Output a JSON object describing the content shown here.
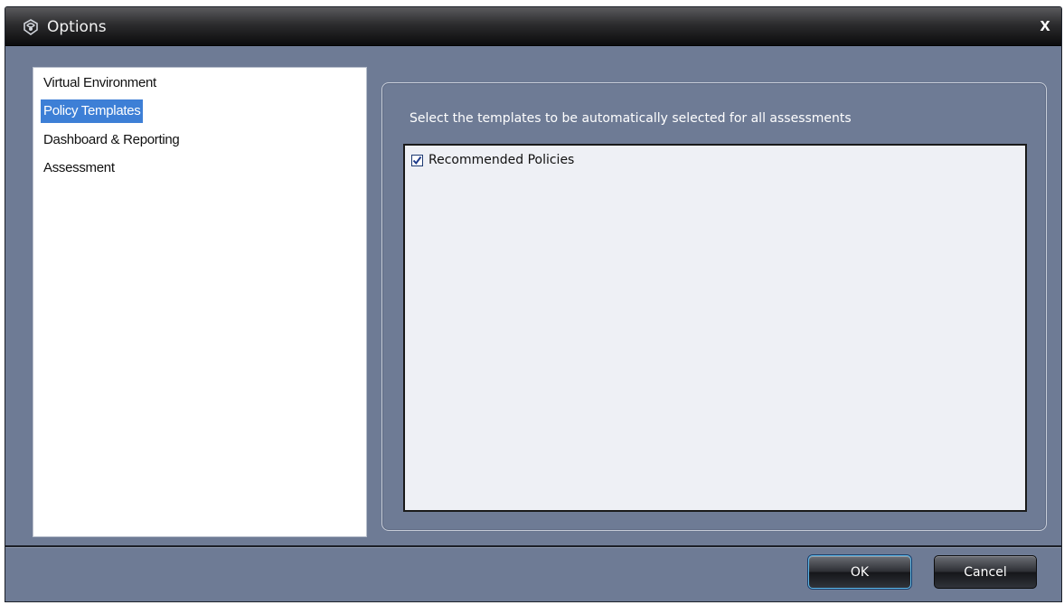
{
  "window": {
    "title": "Options",
    "icon": "app-logo-icon",
    "close_glyph": "x"
  },
  "nav": {
    "items": [
      {
        "label": "Virtual Environment",
        "selected": false
      },
      {
        "label": "Policy Templates",
        "selected": true
      },
      {
        "label": "Dashboard & Reporting",
        "selected": false
      },
      {
        "label": "Assessment",
        "selected": false
      }
    ]
  },
  "main": {
    "instruction": "Select the templates to be automatically selected for all assessments",
    "templates": [
      {
        "label": "Recommended Policies",
        "checked": true
      }
    ]
  },
  "footer": {
    "ok_label": "OK",
    "cancel_label": "Cancel"
  },
  "colors": {
    "dialog_bg": "#6e7b95",
    "selection": "#3d7fd6",
    "list_bg": "#eef0f5"
  }
}
